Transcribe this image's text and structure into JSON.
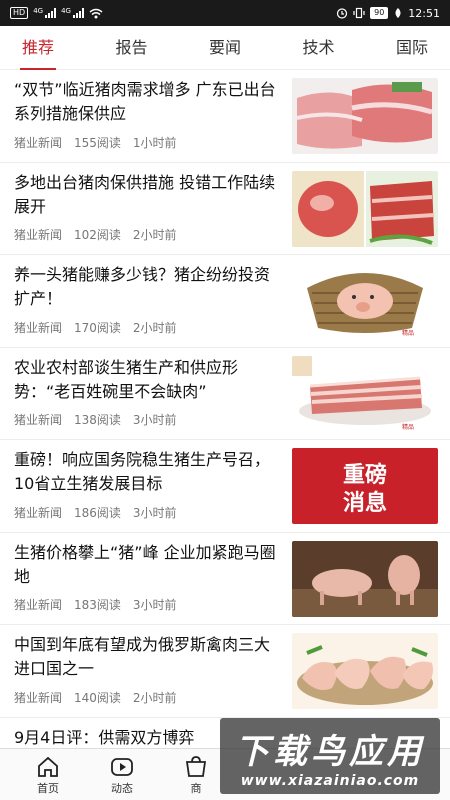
{
  "status_bar": {
    "left_badge": "HD",
    "net_labels": [
      "4G",
      "4G"
    ],
    "battery": "90",
    "time": "12:51"
  },
  "tabs": [
    {
      "label": "推荐",
      "active": true
    },
    {
      "label": "报告",
      "active": false
    },
    {
      "label": "要闻",
      "active": false
    },
    {
      "label": "技术",
      "active": false
    },
    {
      "label": "国际",
      "active": false
    }
  ],
  "accent_color": "#c7252b",
  "news": [
    {
      "title": "“双节”临近猪肉需求增多 广东已出台系列措施保供应",
      "source": "猪业新闻",
      "reads": "155阅读",
      "time": "1小时前",
      "image": "pork-slabs"
    },
    {
      "title": "多地出台猪肉保供措施 投错工作陆续展开",
      "source": "猪业新闻",
      "reads": "102阅读",
      "time": "2小时前",
      "image": "pork-cuts"
    },
    {
      "title": "养一头猪能赚多少钱？猪企纷纷投资扩产！",
      "source": "猪业新闻",
      "reads": "170阅读",
      "time": "2小时前",
      "image": "pig-in-basket"
    },
    {
      "title": "农业农村部谈生猪生产和供应形势：“老百姓碗里不会缺肉”",
      "source": "猪业新闻",
      "reads": "138阅读",
      "time": "3小时前",
      "image": "pork-belly"
    },
    {
      "title": "重磅！响应国务院稳生猪生产号召，10省立生猪发展目标",
      "source": "猪业新闻",
      "reads": "186阅读",
      "time": "3小时前",
      "image": "breaking-news-banner",
      "image_text": "重磅\n消息"
    },
    {
      "title": "生猪价格攀上“猪”峰 企业加紧跑马圈地",
      "source": "猪业新闻",
      "reads": "183阅读",
      "time": "3小时前",
      "image": "pigs-in-field"
    },
    {
      "title": "中国到年底有望成为俄罗斯禽肉三大进口国之一",
      "source": "猪业新闻",
      "reads": "140阅读",
      "time": "2小时前",
      "image": "chicken-legs"
    }
  ],
  "partial_item": {
    "title": "9月4日评：供需双方博弈"
  },
  "bottom_nav": [
    {
      "label": "首页",
      "icon": "home-icon"
    },
    {
      "label": "动态",
      "icon": "video-icon"
    },
    {
      "label": "商",
      "icon": "shop-icon"
    }
  ],
  "watermark": {
    "main": "下载鸟应用",
    "sub": "www.xiazainiao.com"
  }
}
